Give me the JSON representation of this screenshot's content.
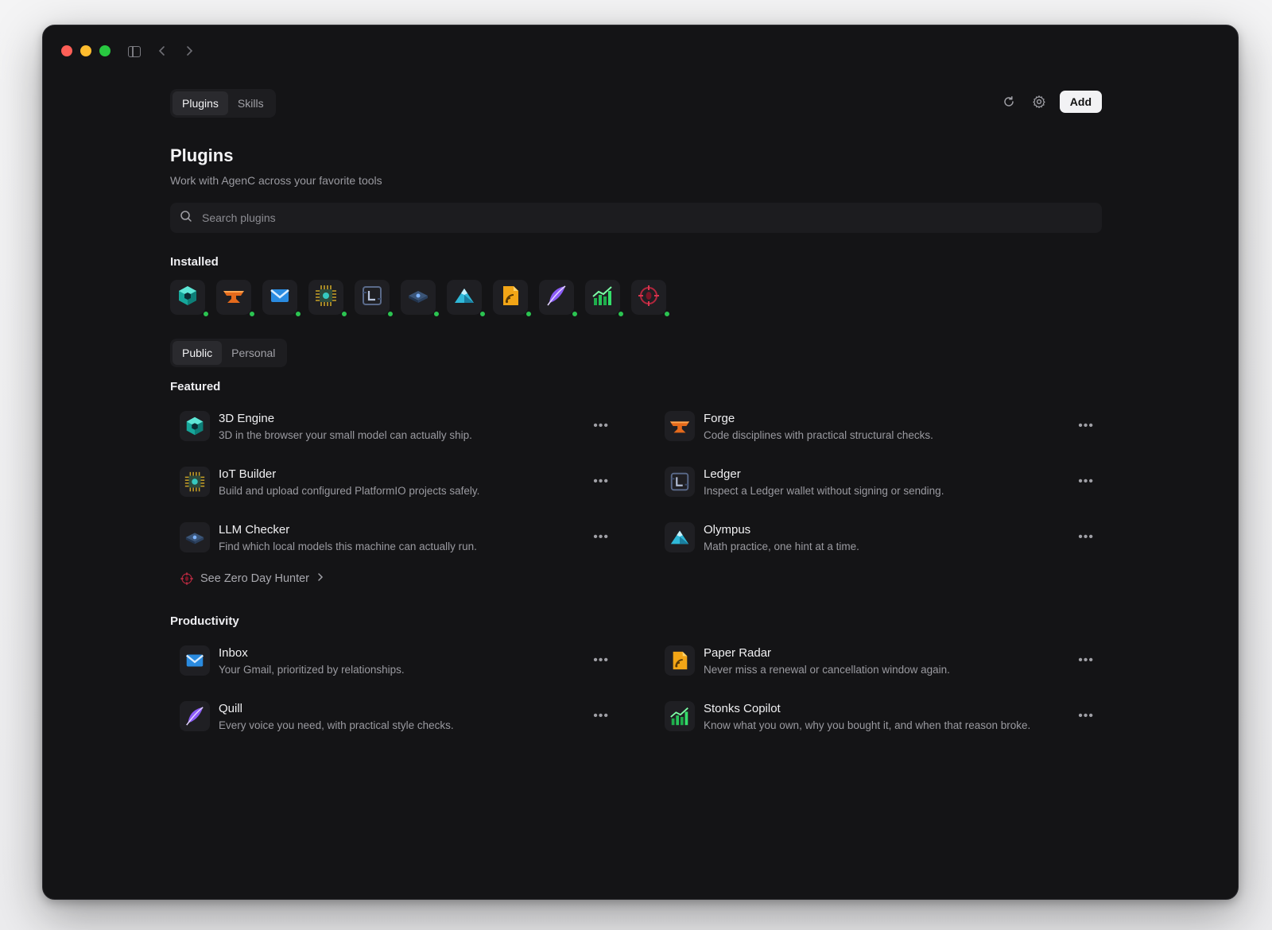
{
  "header": {
    "tabs": [
      {
        "label": "Plugins",
        "active": true
      },
      {
        "label": "Skills",
        "active": false
      }
    ],
    "add_label": "Add"
  },
  "page": {
    "title": "Plugins",
    "subtitle": "Work with AgenC across your favorite tools"
  },
  "search": {
    "placeholder": "Search plugins"
  },
  "installed": {
    "heading": "Installed",
    "items": [
      {
        "icon": "cube-icon",
        "status": "active"
      },
      {
        "icon": "anvil-icon",
        "status": "active"
      },
      {
        "icon": "envelope-icon",
        "status": "active"
      },
      {
        "icon": "chip-icon",
        "status": "active"
      },
      {
        "icon": "ledger-icon",
        "status": "active"
      },
      {
        "icon": "llm-chip-icon",
        "status": "active"
      },
      {
        "icon": "mountain-icon",
        "status": "active"
      },
      {
        "icon": "radar-doc-icon",
        "status": "active"
      },
      {
        "icon": "feather-icon",
        "status": "active"
      },
      {
        "icon": "stocks-chart-icon",
        "status": "active"
      },
      {
        "icon": "crosshair-bug-icon",
        "status": "active"
      }
    ]
  },
  "filter_tabs": [
    {
      "label": "Public",
      "active": true
    },
    {
      "label": "Personal",
      "active": false
    }
  ],
  "featured": {
    "heading": "Featured",
    "items": [
      {
        "name": "3D Engine",
        "desc": "3D in the browser your small model can actually ship.",
        "icon": "cube-icon"
      },
      {
        "name": "Forge",
        "desc": "Code disciplines with practical structural checks.",
        "icon": "anvil-icon"
      },
      {
        "name": "IoT Builder",
        "desc": "Build and upload configured PlatformIO projects safely.",
        "icon": "chip-icon"
      },
      {
        "name": "Ledger",
        "desc": "Inspect a Ledger wallet without signing or sending.",
        "icon": "ledger-icon"
      },
      {
        "name": "LLM Checker",
        "desc": "Find which local models this machine can actually run.",
        "icon": "llm-chip-icon"
      },
      {
        "name": "Olympus",
        "desc": "Math practice, one hint at a time.",
        "icon": "mountain-icon"
      }
    ],
    "see_more": "See Zero Day Hunter"
  },
  "productivity": {
    "heading": "Productivity",
    "items": [
      {
        "name": "Inbox",
        "desc": "Your Gmail, prioritized by relationships.",
        "icon": "envelope-icon"
      },
      {
        "name": "Paper Radar",
        "desc": "Never miss a renewal or cancellation window again.",
        "icon": "radar-doc-icon"
      },
      {
        "name": "Quill",
        "desc": "Every voice you need, with practical style checks.",
        "icon": "feather-icon"
      },
      {
        "name": "Stonks Copilot",
        "desc": "Know what you own, why you bought it, and when that reason broke.",
        "icon": "stocks-chart-icon"
      }
    ]
  },
  "colors": {
    "background": "#141416",
    "status_dot": "#2bc451",
    "accent_button": "#f2f2f4"
  }
}
